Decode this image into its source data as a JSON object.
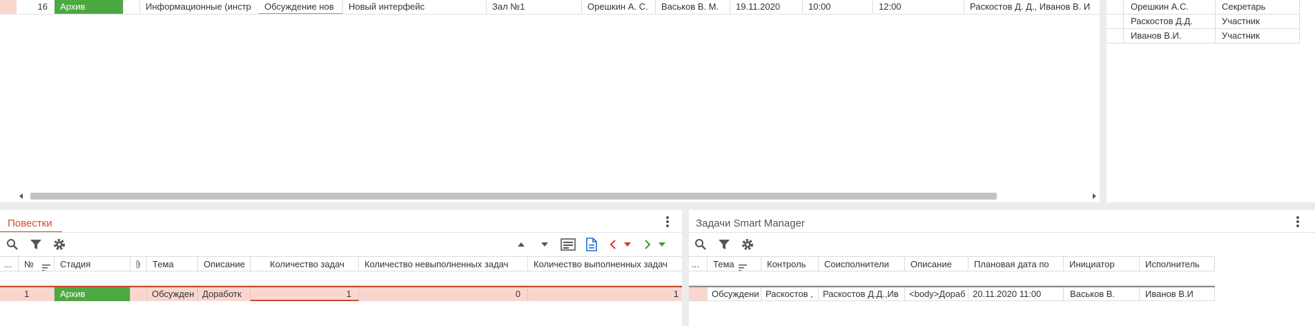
{
  "top_table": {
    "row": {
      "num": "16",
      "stage": "Архив",
      "type": "Информационные (инстр",
      "topic": "Обсуждение нов",
      "subject": "Новый интерфейс",
      "place": "Зал №1",
      "secretary": "Орешкин А. С.",
      "chair": "Васьков В. М.",
      "date": "19.11.2020",
      "start": "10:00",
      "end": "12:00",
      "participants": "Раскостов Д. Д., Иванов В. И"
    }
  },
  "members": [
    {
      "name": "Орешкин А.С.",
      "role": "Секретарь"
    },
    {
      "name": "Раскостов Д.Д.",
      "role": "Участник"
    },
    {
      "name": "Иванов В.И.",
      "role": "Участник"
    }
  ],
  "agenda": {
    "title": "Повестки",
    "columns": {
      "more": "...",
      "num": "№",
      "stage": "Стадия",
      "topic": "Тема",
      "description": "Описание",
      "task_count": "Количество задач",
      "unfinished": "Количество невыполненных задач",
      "finished": "Количество выполненных задач"
    },
    "row": {
      "num": "1",
      "stage": "Архив",
      "topic": "Обсужден",
      "description": "Доработк",
      "task_count": "1",
      "unfinished": "0",
      "finished": "1"
    }
  },
  "tasks": {
    "title": "Задачи Smart Manager",
    "columns": {
      "more": "...",
      "topic": "Тема",
      "control": "Контроль",
      "coexecutors": "Соисполнители",
      "description": "Описание",
      "planned_date": "Плановая дата по",
      "initiator": "Инициатор",
      "executor": "Исполнитель"
    },
    "row": {
      "topic": "Обсуждени",
      "control": "Раскостов ,",
      "coexecutors": "Раскостов Д.Д.,Ив",
      "description": "<body>Дораб",
      "planned_date": "20.11.2020 11:00",
      "initiator": "Васьков В.",
      "executor": "Иванов В.И"
    }
  },
  "colors": {
    "stage_green": "#4ca840",
    "selected_row": "#f9d7ce",
    "title_red": "#d9462a",
    "nav_red": "#d9312a",
    "nav_green": "#3a9a2e",
    "doc_blue": "#1a6fd6"
  }
}
